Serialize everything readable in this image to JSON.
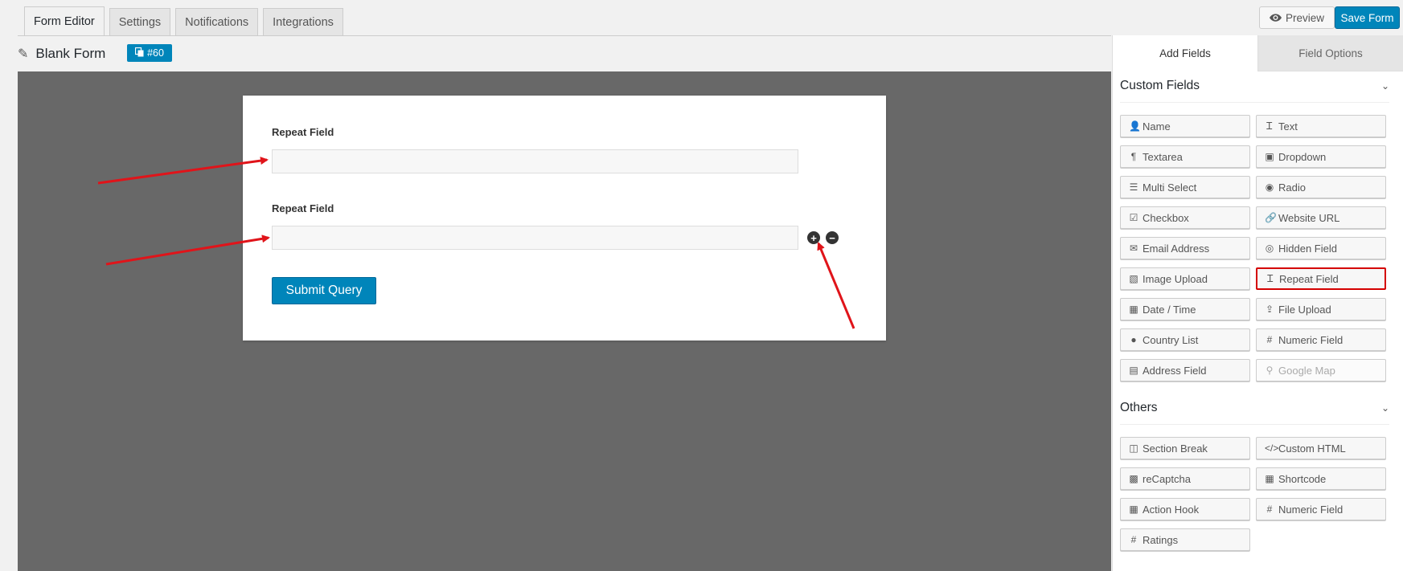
{
  "tabs": [
    "Form Editor",
    "Settings",
    "Notifications",
    "Integrations"
  ],
  "header": {
    "preview": "Preview",
    "save": "Save Form"
  },
  "form": {
    "title": "Blank Form",
    "id_badge": "#60"
  },
  "canvas": {
    "field1_label": "Repeat Field",
    "field2_label": "Repeat Field",
    "add_symbol": "+",
    "remove_symbol": "−",
    "submit": "Submit Query"
  },
  "panel": {
    "tab_add": "Add Fields",
    "tab_options": "Field Options",
    "custom_title": "Custom Fields",
    "others_title": "Others",
    "custom_fields": [
      {
        "label": "Name",
        "icon": "user-icon"
      },
      {
        "label": "Text",
        "icon": "text-cursor-icon"
      },
      {
        "label": "Textarea",
        "icon": "paragraph-icon"
      },
      {
        "label": "Dropdown",
        "icon": "dropdown-icon"
      },
      {
        "label": "Multi Select",
        "icon": "list-icon"
      },
      {
        "label": "Radio",
        "icon": "radio-icon"
      },
      {
        "label": "Checkbox",
        "icon": "checkbox-icon"
      },
      {
        "label": "Website URL",
        "icon": "link-icon"
      },
      {
        "label": "Email Address",
        "icon": "envelope-icon"
      },
      {
        "label": "Hidden Field",
        "icon": "eye-slash-icon"
      },
      {
        "label": "Image Upload",
        "icon": "image-icon"
      },
      {
        "label": "Repeat Field",
        "icon": "text-cursor-icon",
        "highlighted": true
      },
      {
        "label": "Date / Time",
        "icon": "calendar-icon"
      },
      {
        "label": "File Upload",
        "icon": "upload-icon"
      },
      {
        "label": "Country List",
        "icon": "globe-icon"
      },
      {
        "label": "Numeric Field",
        "icon": "hash-icon"
      },
      {
        "label": "Address Field",
        "icon": "address-card-icon"
      },
      {
        "label": "Google Map",
        "icon": "map-marker-icon",
        "disabled": true
      }
    ],
    "other_fields": [
      {
        "label": "Section Break",
        "icon": "columns-icon"
      },
      {
        "label": "Custom HTML",
        "icon": "code-icon"
      },
      {
        "label": "reCaptcha",
        "icon": "qrcode-icon"
      },
      {
        "label": "Shortcode",
        "icon": "calendar-icon"
      },
      {
        "label": "Action Hook",
        "icon": "calendar-icon"
      },
      {
        "label": "Numeric Field",
        "icon": "hash-icon"
      },
      {
        "label": "Ratings",
        "icon": "hash-icon"
      }
    ]
  },
  "colors": {
    "accent": "#0085ba",
    "highlight": "#d40000",
    "arrow": "#e0141a",
    "canvas": "#686868"
  }
}
